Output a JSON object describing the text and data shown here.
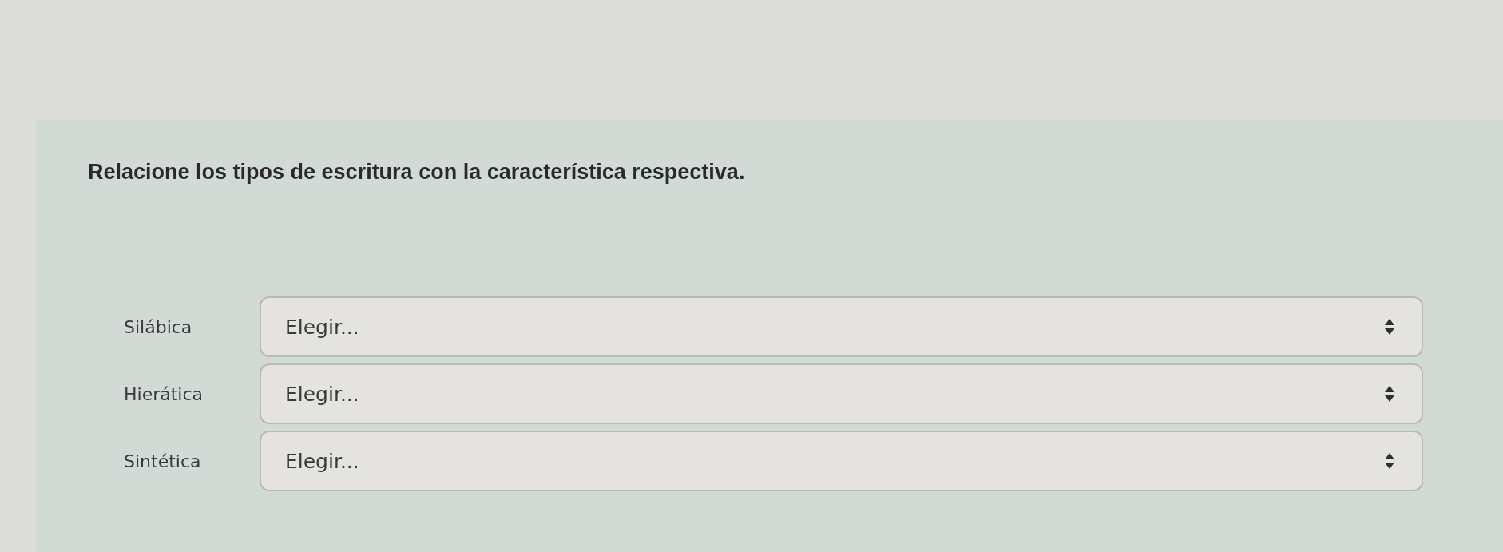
{
  "question": {
    "text": "Relacione los tipos de escritura con la característica respectiva."
  },
  "rows": [
    {
      "label": "Silábica",
      "select": {
        "value": "Elegir..."
      }
    },
    {
      "label": "Hierática",
      "select": {
        "value": "Elegir..."
      }
    },
    {
      "label": "Sintética",
      "select": {
        "value": "Elegir..."
      }
    }
  ]
}
